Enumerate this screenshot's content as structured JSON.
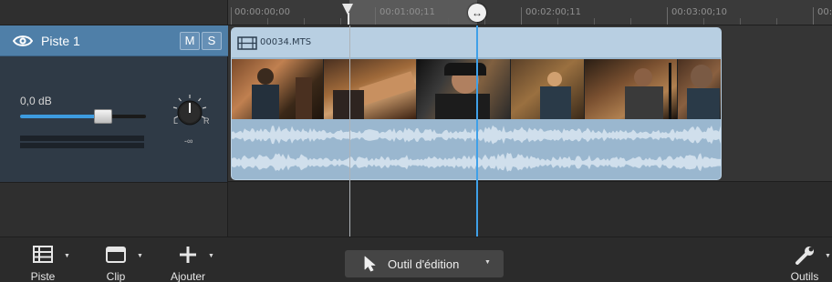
{
  "ruler": {
    "timecodes": [
      "00:00:00;00",
      "00:01:00;11",
      "00:02:00;11",
      "00:03:00;10",
      "00:0"
    ]
  },
  "track": {
    "name": "Piste 1",
    "mute_label": "M",
    "solo_label": "S",
    "volume_label": "0,0 dB",
    "volume_level": 0.66,
    "pan_left": "L",
    "pan_right": "R",
    "pan_value": "-∞",
    "header_color": "#4f7fa8"
  },
  "clip": {
    "name": "00034.MTS",
    "color": "#9ab7cf",
    "thumbnail_count": 7
  },
  "playhead": {
    "color": "#3fa0e8"
  },
  "toolbar": {
    "piste_label": "Piste",
    "clip_label": "Clip",
    "ajouter_label": "Ajouter",
    "edit_tool_label": "Outil d'édition",
    "outils_label": "Outils"
  }
}
